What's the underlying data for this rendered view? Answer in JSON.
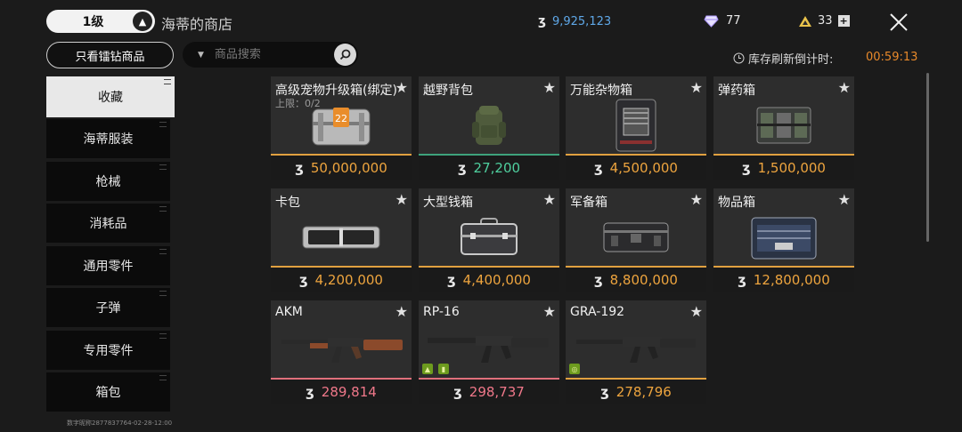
{
  "header": {
    "level": "1级",
    "shop_title": "海蒂的商店",
    "coins": "9,925,123",
    "diamonds": "77",
    "tokens": "33"
  },
  "filters": {
    "only_diamond_label": "只看镭钻商品",
    "search_placeholder": "商品搜索",
    "refresh_label": "库存刷新倒计时:",
    "countdown": "00:59:13"
  },
  "sidebar": {
    "items": [
      {
        "label": "收藏"
      },
      {
        "label": "海蒂服装"
      },
      {
        "label": "枪械"
      },
      {
        "label": "消耗品"
      },
      {
        "label": "通用零件"
      },
      {
        "label": "子弹"
      },
      {
        "label": "专用零件"
      },
      {
        "label": "箱包"
      }
    ]
  },
  "items": [
    {
      "name": "高级宠物升级箱(绑定)",
      "limit": "上限：0/2",
      "price": "50,000,000"
    },
    {
      "name": "越野背包",
      "price": "27,200"
    },
    {
      "name": "万能杂物箱",
      "price": "4,500,000"
    },
    {
      "name": "弹药箱",
      "price": "1,500,000"
    },
    {
      "name": "卡包",
      "price": "4,200,000"
    },
    {
      "name": "大型钱箱",
      "price": "4,400,000"
    },
    {
      "name": "军备箱",
      "price": "8,800,000"
    },
    {
      "name": "物品箱",
      "price": "12,800,000"
    },
    {
      "name": "AKM",
      "price": "289,814"
    },
    {
      "name": "RP-16",
      "price": "298,737"
    },
    {
      "name": "GRA-192",
      "price": "278,796"
    }
  ],
  "footer": {
    "id_text": "数字昵称2877837764-02-28-12:00"
  },
  "colors": {
    "accent_orange": "#eda43e",
    "accent_green": "#4fcf9e",
    "accent_pink": "#f0788a",
    "coin_blue": "#5fa8e8"
  }
}
